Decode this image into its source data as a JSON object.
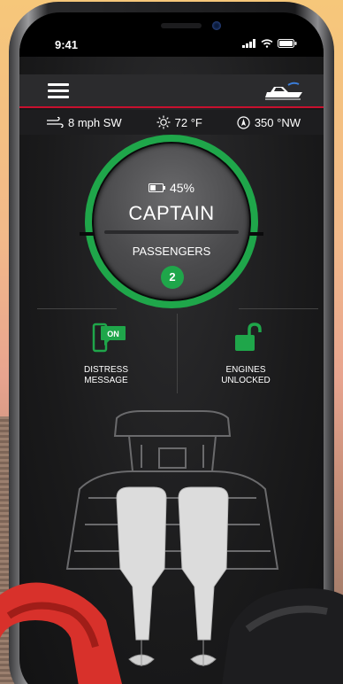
{
  "status_bar": {
    "time": "9:41"
  },
  "conditions": {
    "wind": "8 mph SW",
    "temperature": "72 °F",
    "heading": "350 °NW"
  },
  "control_dial": {
    "battery_percent": "45%",
    "battery_level": 0.45,
    "mode_label": "CAPTAIN",
    "passengers_label": "PASSENGERS",
    "passenger_count": "2"
  },
  "status_tiles": {
    "distress": {
      "badge": "ON",
      "line1": "DISTRESS",
      "line2": "MESSAGE"
    },
    "engines": {
      "line1": "ENGINES",
      "line2": "UNLOCKED"
    }
  },
  "colors": {
    "accent_green": "#1fa64a",
    "accent_red": "#c8102e",
    "background": "#1a1a1b"
  }
}
